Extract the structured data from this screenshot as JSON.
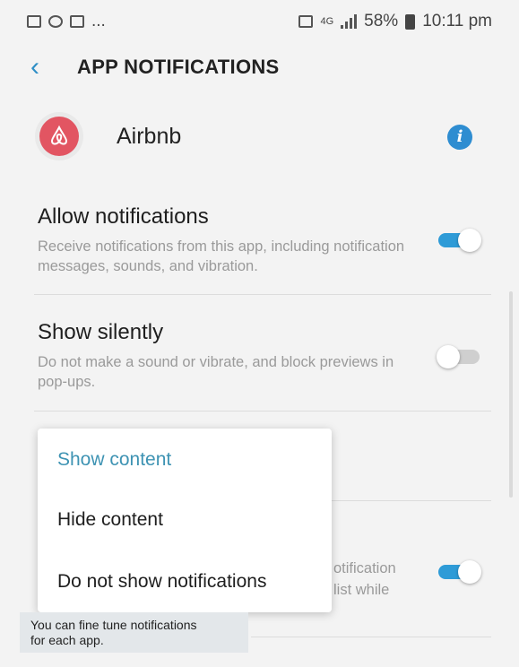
{
  "status_bar": {
    "left_icons": [
      "gallery-icon",
      "sync-icon",
      "lock-icon"
    ],
    "left_more": "...",
    "network": "4G",
    "battery_pct": "58%",
    "time": "10:11 pm"
  },
  "header": {
    "back_icon": "chevron-left-icon",
    "title": "APP NOTIFICATIONS"
  },
  "app": {
    "name": "Airbnb",
    "info_icon": "i"
  },
  "settings": {
    "allow": {
      "title": "Allow notifications",
      "description": "Receive notifications from this app, including notification messages, sounds, and vibration.",
      "enabled": true
    },
    "silent": {
      "title": "Show silently",
      "description": "Do not make a sound or vibrate, and block previews in pop-ups.",
      "enabled": false
    },
    "partial": {
      "line1": "otification",
      "line2": "list while",
      "enabled": true
    }
  },
  "popup": {
    "options": [
      "Show content",
      "Hide content",
      "Do not show notifications"
    ],
    "selected": "Show content"
  },
  "tooltip": {
    "text_line1": "You can fine tune notifications",
    "text_line2": "for each app."
  },
  "colors": {
    "accent": "#2e9bd7",
    "airbnb": "#e25562",
    "selected_option": "#3e93b3"
  }
}
